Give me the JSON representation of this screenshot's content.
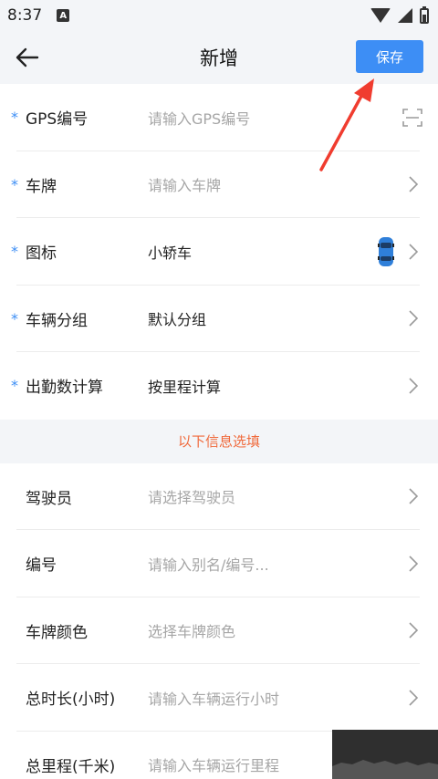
{
  "status": {
    "time": "8:37",
    "notif_icon": "A"
  },
  "header": {
    "title": "新增",
    "save_label": "保存"
  },
  "required_fields": [
    {
      "label": "GPS编号",
      "value": "请输入GPS编号",
      "placeholder": true,
      "trailing": "scan-icon"
    },
    {
      "label": "车牌",
      "value": "请输入车牌",
      "placeholder": true,
      "trailing": "chevron-right-icon"
    },
    {
      "label": "图标",
      "value": "小轿车",
      "placeholder": false,
      "trailing": "chevron-right-icon"
    },
    {
      "label": "车辆分组",
      "value": "默认分组",
      "placeholder": false,
      "trailing": "chevron-right-icon"
    },
    {
      "label": "出勤数计算",
      "value": "按里程计算",
      "placeholder": false,
      "trailing": "chevron-right-icon"
    }
  ],
  "notice": "以下信息选填",
  "optional_fields": [
    {
      "label": "驾驶员",
      "value": "请选择驾驶员",
      "placeholder": true
    },
    {
      "label": "编号",
      "value": "请输入别名/编号...",
      "placeholder": true
    },
    {
      "label": "车牌颜色",
      "value": "选择车牌颜色",
      "placeholder": true
    },
    {
      "label": "总时长(小时)",
      "value": "请输入车辆运行小时",
      "placeholder": true
    },
    {
      "label": "总里程(千米)",
      "value": "请输入车辆运行里程",
      "placeholder": true
    }
  ],
  "colors": {
    "accent": "#3d8ef5",
    "notice": "#f06a3c",
    "annotation": "#f03c2f"
  }
}
